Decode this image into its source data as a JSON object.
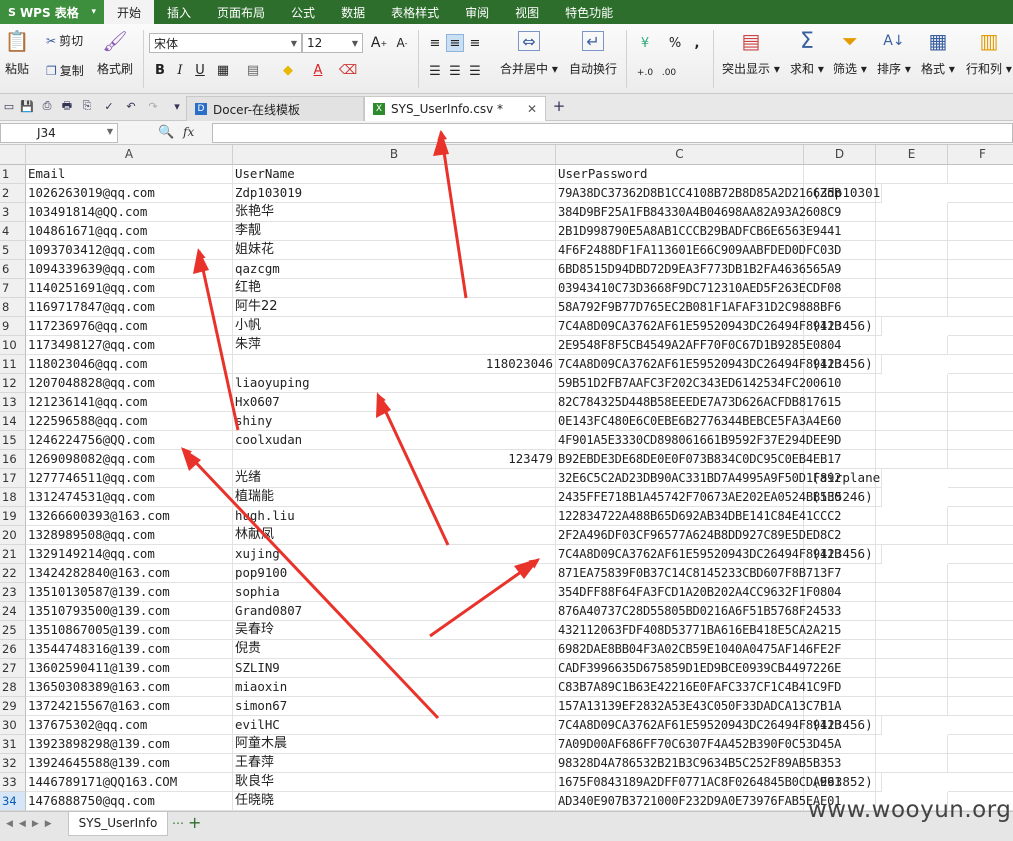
{
  "app": {
    "title": "WPS 表格",
    "logo": "S"
  },
  "menu": [
    "开始",
    "插入",
    "页面布局",
    "公式",
    "数据",
    "表格样式",
    "审阅",
    "视图",
    "特色功能"
  ],
  "ribbon": {
    "paste": "粘贴",
    "cut": "剪切",
    "copy": "复制",
    "format_painter": "格式刷",
    "font_name": "宋体",
    "font_size": "12",
    "bold": "B",
    "italic": "I",
    "underline": "U",
    "merge_center": "合并居中",
    "wrap_text": "自动换行",
    "highlight": "突出显示",
    "sum": "求和",
    "filter": "筛选",
    "sort": "排序",
    "format": "格式",
    "rows_cols": "行和列"
  },
  "tabs": {
    "docer": "Docer-在线模板",
    "file": "SYS_UserInfo.csv *"
  },
  "formula": {
    "name_box": "J34",
    "fx": "fx",
    "value": ""
  },
  "sheet": {
    "columns": [
      "A",
      "B",
      "C",
      "D",
      "E",
      "F"
    ],
    "rows": [
      [
        "Email",
        "UserName",
        "UserPassword",
        ""
      ],
      [
        "1026263019@qq.com",
        "Zdp103019",
        "79A38DC37362D8B1CC4108B72B8D85A2D216635B",
        "(Zdp103019)"
      ],
      [
        "103491814@QQ.com",
        "张艳华",
        "384D9BF25A1FB84330A4B04698AA82A93A2608C9",
        ""
      ],
      [
        "104861671@qq.com",
        "李靓",
        "2B1D998790E5A8AB1CCCB29BADFCB6E6563E9441",
        ""
      ],
      [
        "1093703412@qq.com",
        "姐妹花",
        "4F6F2488DF1FA113601E66C909AABFDED0DFC03D",
        ""
      ],
      [
        "1094339639@qq.com",
        "qazcgm",
        "6BD8515D94DBD72D9EA3F773DB1B2FA4636565A9",
        ""
      ],
      [
        "1140251691@qq.com",
        "红艳",
        "03943410C73D3668F9DC712310AED5F263ECDF08",
        ""
      ],
      [
        "1169717847@qq.com",
        "阿牛22",
        "58A792F9B77D765EC2B081F1AFAF31D2C9888BF6",
        ""
      ],
      [
        "117236976@qq.com",
        "小帆",
        "7C4A8D09CA3762AF61E59520943DC26494F8941B",
        "(123456)"
      ],
      [
        "1173498127@qq.com",
        "朱萍",
        "2E9548F8F5CB4549A2AFF70F0C67D1B9285E0804",
        ""
      ],
      [
        "118023046@qq.com",
        "118023046",
        "7C4A8D09CA3762AF61E59520943DC26494F8941B",
        "(123456)"
      ],
      [
        "1207048828@qq.com",
        "liaoyuping",
        "59B51D2FB7AAFC3F202C343ED6142534FC200610",
        ""
      ],
      [
        "121236141@qq.com",
        "Hx0607",
        "82C784325D448B58EEEDE7A73D626ACFDB817615",
        ""
      ],
      [
        "122596588@qq.com",
        "shiny",
        "0E143FC480E6C0EBE6B2776344BEBCE5FA3A4E60",
        ""
      ],
      [
        "1246224756@QQ.com",
        "coolxudan",
        "4F901A5E3330CD898061661B9592F37E294DEE9D",
        ""
      ],
      [
        "1269098082@qq.com",
        "123479",
        "B92EBDE3DE68DE0E0F073B834C0DC95C0EB4EB17",
        ""
      ],
      [
        "1277746511@qq.com",
        "光绪",
        "32E6C5C2AD23DB90AC331BD7A4995A9F50D1F892",
        "(airplane)"
      ],
      [
        "1312474531@qq.com",
        "植瑞能",
        "2435FFE718B1A45742F70673AE202EA0524BB5E0",
        "(135246)"
      ],
      [
        "13266600393@163.com",
        "hugh.liu",
        "122834722A488B65D692AB34DBE141C84E41CCC2",
        ""
      ],
      [
        "1328989508@qq.com",
        "林献凤",
        "2F2A496DF03CF96577A624B8DD927C89E5DED8C2",
        ""
      ],
      [
        "1329149214@qq.com",
        "xujing",
        "7C4A8D09CA3762AF61E59520943DC26494F8941B",
        "(123456)"
      ],
      [
        "13424282840@163.com",
        "pop9100",
        "871EA75839F0B37C14C8145233CBD607F8B713F7",
        ""
      ],
      [
        "13510130587@139.com",
        "sophia",
        "354DFF88F64FA3FCD1A20B202A4CC9632F1F0804",
        ""
      ],
      [
        "13510793500@139.com",
        "Grand0807",
        "876A40737C28D55805BD0216A6F51B5768F24533",
        ""
      ],
      [
        "13510867005@139.com",
        "吴春玲",
        "432112063FDF408D53771BA616EB418E5CA2A215",
        ""
      ],
      [
        "13544748316@139.com",
        "倪贵",
        "6982DAE8BB04F3A02CB59E1040A0475AF146FE2F",
        ""
      ],
      [
        "13602590411@139.com",
        "SZLIN9",
        "CADF3996635D675859D1ED9BCE0939CB4497226E",
        ""
      ],
      [
        "13650308389@163.com",
        "miaoxin",
        "C83B7A89C1B63E42216E0FAFC337CF1C4B41C9FD",
        ""
      ],
      [
        "13724215567@163.com",
        "simon67",
        "157A13139EF2832A53E43C050F33DADCA13C7B1A",
        ""
      ],
      [
        "137675302@qq.com",
        "evilHC",
        "7C4A8D09CA3762AF61E59520943DC26494F8941B",
        "(123456)"
      ],
      [
        "13923898298@139.com",
        "阿童木晨",
        "7A09D00AF686FF70C6307F4A452B390F0C53D45A",
        ""
      ],
      [
        "13924645588@139.com",
        "王春萍",
        "98328D4A786532B21B3C9634B5C252F89AB5B353",
        ""
      ],
      [
        "1446789171@QQ163.COM",
        "耿良华",
        "1675F0843189A2DFF0771AC8F0264845B0CDAE91",
        "(963852)"
      ],
      [
        "1476888750@qq.com",
        "任晓晓",
        "AD340E907B3721000F232D9A0E73976FAB5EAE01",
        ""
      ]
    ],
    "selected_row": 34
  },
  "sheet_tab": "SYS_UserInfo",
  "watermark": "www.wooyun.org",
  "colors": {
    "menubar": "#2d6e2d",
    "arrow": "#e8322a",
    "selected_header": "#d6e6f6"
  }
}
